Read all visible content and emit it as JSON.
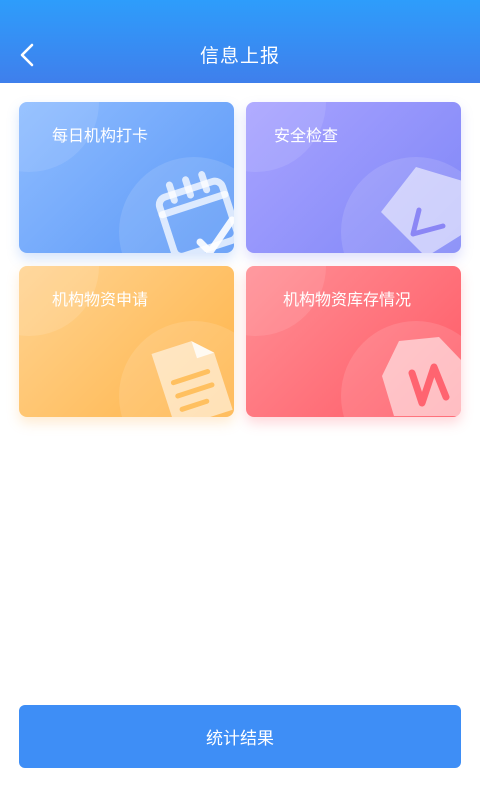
{
  "header": {
    "title": "信息上报"
  },
  "cards": [
    {
      "label": "每日机构打卡",
      "icon": "calendar-check-icon",
      "color": "#6aa4fa"
    },
    {
      "label": "安全检查",
      "icon": "shield-check-icon",
      "color": "#8e8efa"
    },
    {
      "label": "机构物资申请",
      "icon": "document-icon",
      "color": "#ffc062"
    },
    {
      "label": "机构物资库存情况",
      "icon": "stock-chart-icon",
      "color": "#ff6c76"
    }
  ],
  "footer": {
    "button_label": "统计结果"
  },
  "colors": {
    "primary": "#3e8ef6",
    "header": "#3f8cf3"
  }
}
